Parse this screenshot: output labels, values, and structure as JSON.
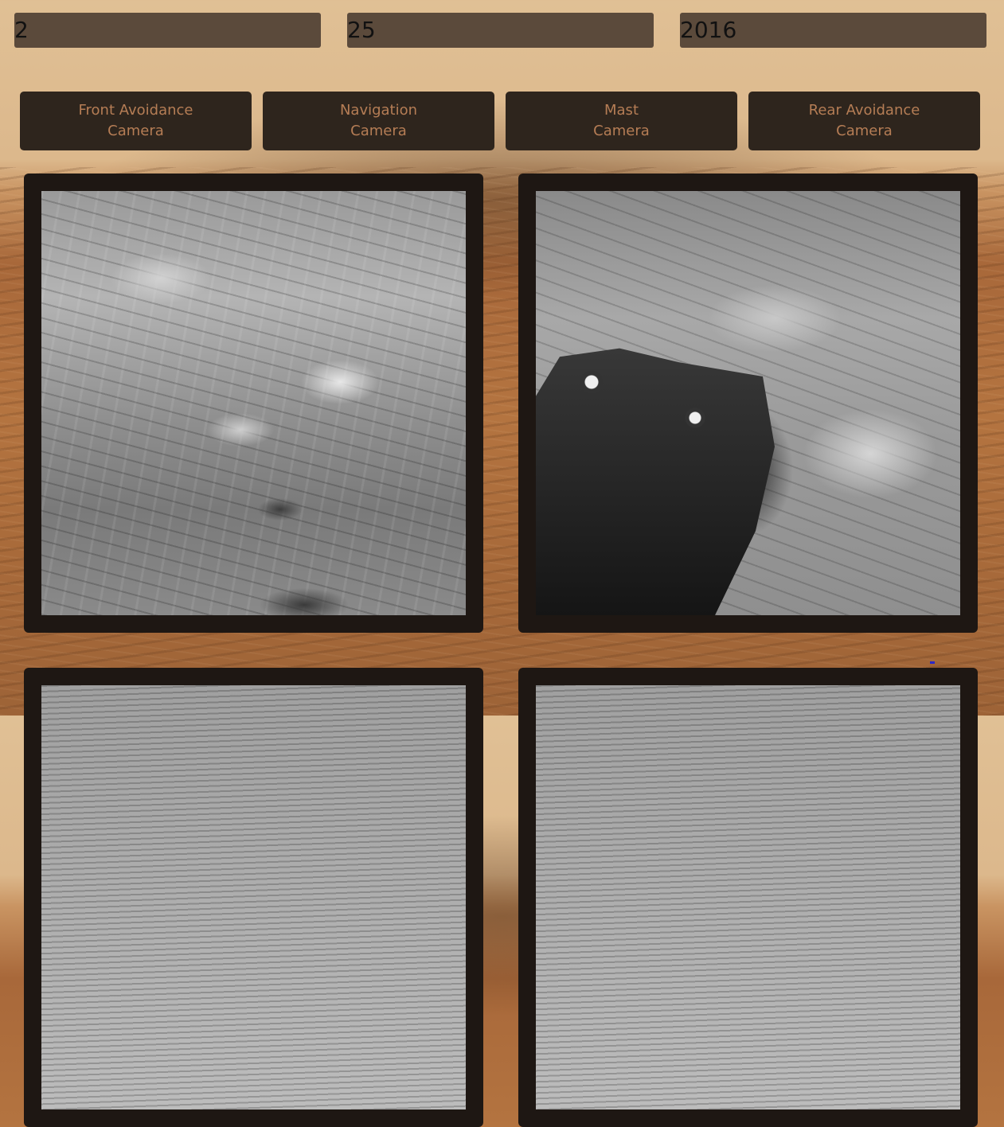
{
  "filters": {
    "month": "2",
    "day": "25",
    "year": "2016"
  },
  "cameras": [
    {
      "line1": "Front Avoidance",
      "line2": "Camera"
    },
    {
      "line1": "Navigation",
      "line2": "Camera"
    },
    {
      "line1": "Mast",
      "line2": "Camera"
    },
    {
      "line1": "Rear Avoidance",
      "line2": "Camera"
    }
  ],
  "colors": {
    "field_bg": "#5b4a3b",
    "button_bg": "#2e251d",
    "button_text": "#b57d55",
    "card_bg": "#1e1713"
  },
  "photos": [
    {
      "description_icon": "rover-photo"
    },
    {
      "description_icon": "rover-photo"
    },
    {
      "description_icon": "rover-photo"
    },
    {
      "description_icon": "rover-photo"
    }
  ]
}
